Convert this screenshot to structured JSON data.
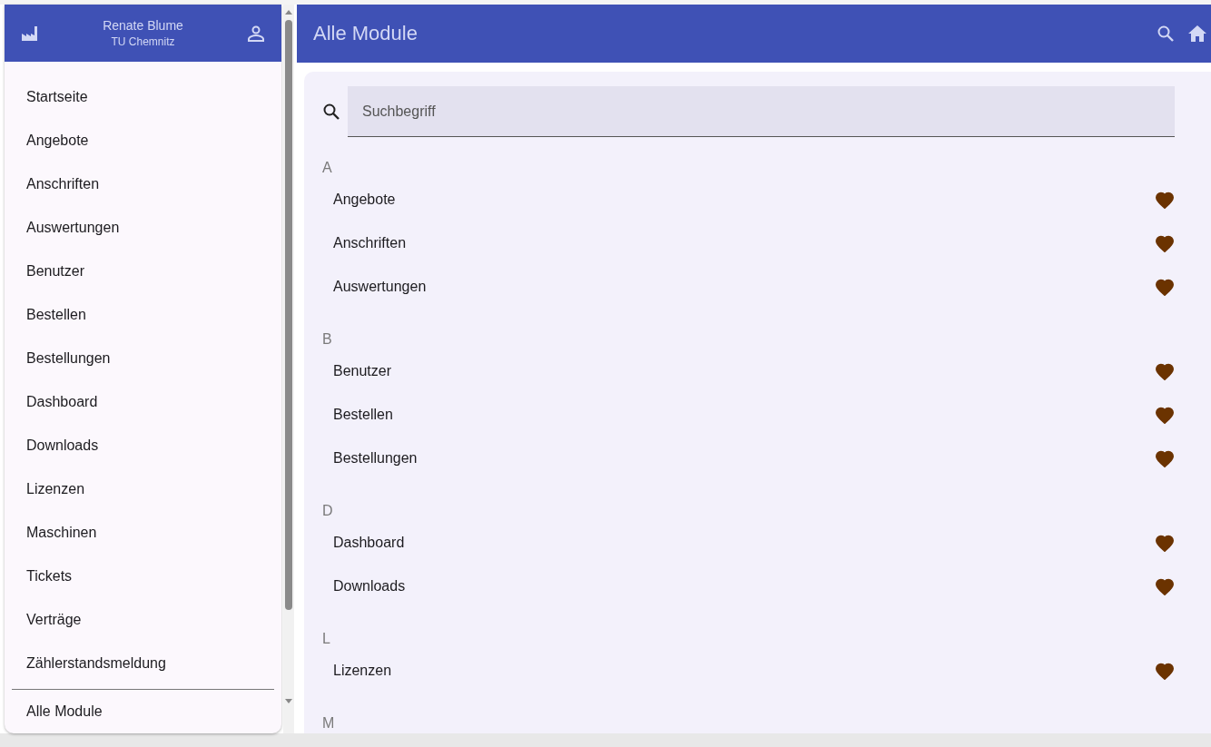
{
  "drawer": {
    "user_name": "Renate Blume",
    "organization": "TU Chemnitz",
    "items": [
      {
        "label": "Startseite"
      },
      {
        "label": "Angebote"
      },
      {
        "label": "Anschriften"
      },
      {
        "label": "Auswertungen"
      },
      {
        "label": "Benutzer"
      },
      {
        "label": "Bestellen"
      },
      {
        "label": "Bestellungen"
      },
      {
        "label": "Dashboard"
      },
      {
        "label": "Downloads"
      },
      {
        "label": "Lizenzen"
      },
      {
        "label": "Maschinen"
      },
      {
        "label": "Tickets"
      },
      {
        "label": "Verträge"
      },
      {
        "label": "Zählerstandsmeldung"
      }
    ],
    "footer_item": {
      "label": "Alle Module"
    }
  },
  "app_bar": {
    "title": "Alle Module"
  },
  "search": {
    "placeholder": "Suchbegriff"
  },
  "groups": [
    {
      "letter": "A",
      "modules": [
        {
          "label": "Angebote",
          "favorite": true
        },
        {
          "label": "Anschriften",
          "favorite": true
        },
        {
          "label": "Auswertungen",
          "favorite": true
        }
      ]
    },
    {
      "letter": "B",
      "modules": [
        {
          "label": "Benutzer",
          "favorite": true
        },
        {
          "label": "Bestellen",
          "favorite": true
        },
        {
          "label": "Bestellungen",
          "favorite": true
        }
      ]
    },
    {
      "letter": "D",
      "modules": [
        {
          "label": "Dashboard",
          "favorite": true
        },
        {
          "label": "Downloads",
          "favorite": true
        }
      ]
    },
    {
      "letter": "L",
      "modules": [
        {
          "label": "Lizenzen",
          "favorite": true
        }
      ]
    },
    {
      "letter": "M"
    }
  ]
}
